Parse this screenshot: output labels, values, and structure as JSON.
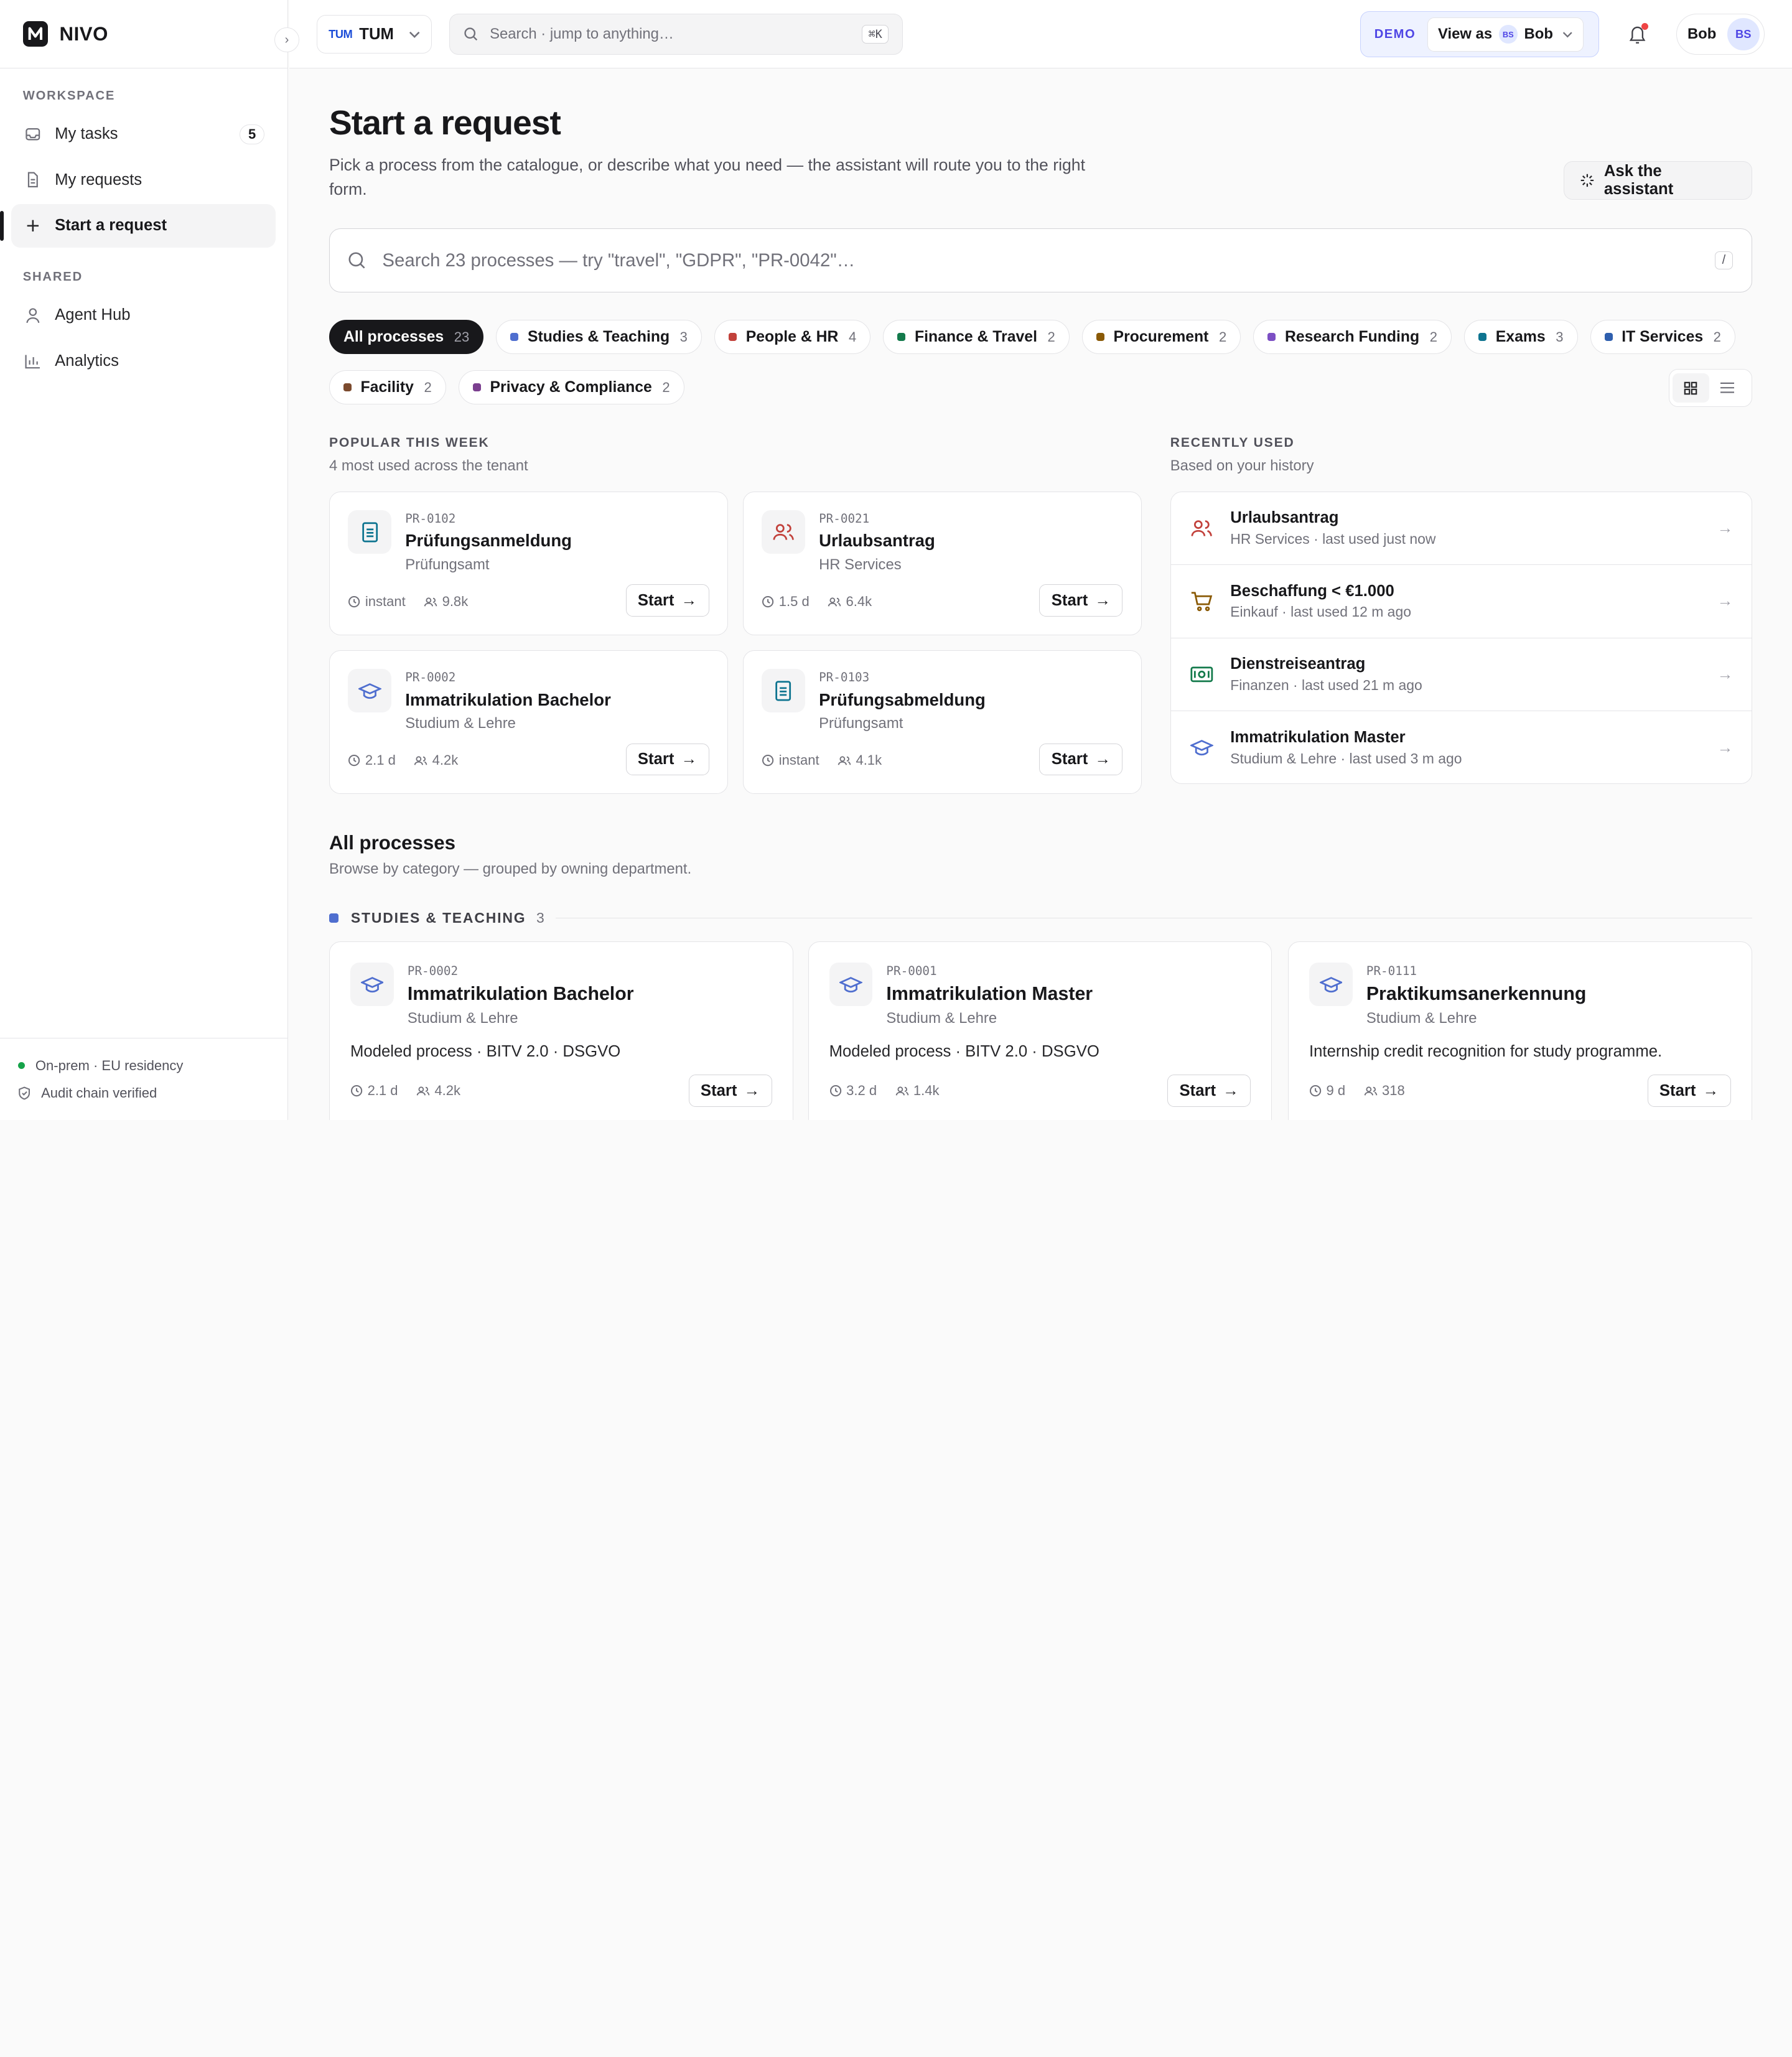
{
  "brand": {
    "name": "NIVO"
  },
  "sidebar": {
    "workspace_label": "WORKSPACE",
    "shared_label": "SHARED",
    "items": [
      {
        "label": "My tasks",
        "count": "5",
        "icon": "inbox-icon"
      },
      {
        "label": "My requests",
        "icon": "document-icon"
      },
      {
        "label": "Start a request",
        "icon": "plus-icon",
        "active": true
      }
    ],
    "shared_items": [
      {
        "label": "Agent Hub",
        "icon": "user-icon"
      },
      {
        "label": "Analytics",
        "icon": "bar-chart-icon"
      }
    ],
    "footer": {
      "residency": "On-prem · EU residency",
      "audit": "Audit chain verified"
    }
  },
  "topbar": {
    "tenant_logo": "TUM",
    "tenant": "TUM",
    "search_placeholder": "Search · jump to anything…",
    "search_shortcut": "⌘K",
    "demo_tag": "DEMO",
    "view_as_label": "View as",
    "view_as_initials": "BS",
    "view_as_user": "Bob",
    "user_name": "Bob",
    "user_initials": "BS"
  },
  "page": {
    "title": "Start a request",
    "subtitle": "Pick a process from the catalogue, or describe what you need — the assistant will route you to the right form.",
    "ask_button": "Ask the assistant",
    "search_placeholder": "Search 23 processes — try \"travel\", \"GDPR\", \"PR-0042\"…",
    "search_shortcut": "/"
  },
  "filters": [
    {
      "label": "All processes",
      "count": "23",
      "color": "#18181b"
    },
    {
      "label": "Studies & Teaching",
      "count": "3",
      "color": "#4f6ecf"
    },
    {
      "label": "People & HR",
      "count": "4",
      "color": "#c2413b"
    },
    {
      "label": "Finance & Travel",
      "count": "2",
      "color": "#137a4b"
    },
    {
      "label": "Procurement",
      "count": "2",
      "color": "#8a5a06"
    },
    {
      "label": "Research Funding",
      "count": "2",
      "color": "#7c4fc4"
    },
    {
      "label": "Exams",
      "count": "3",
      "color": "#0e7490"
    },
    {
      "label": "IT Services",
      "count": "2",
      "color": "#2f5fae"
    },
    {
      "label": "Facility",
      "count": "2",
      "color": "#7b4a2e"
    },
    {
      "label": "Privacy & Compliance",
      "count": "2",
      "color": "#7b3f8f"
    }
  ],
  "popular": {
    "heading": "POPULAR THIS WEEK",
    "subheading": "4 most used across the tenant",
    "cards": [
      {
        "code": "PR-0102",
        "title": "Prüfungsanmeldung",
        "dept": "Prüfungsamt",
        "time": "instant",
        "uses": "9.8k",
        "start": "Start",
        "icon": "document-icon",
        "color": "#0e7490"
      },
      {
        "code": "PR-0021",
        "title": "Urlaubsantrag",
        "dept": "HR Services",
        "time": "1.5 d",
        "uses": "6.4k",
        "start": "Start",
        "icon": "people-icon",
        "color": "#c2413b"
      },
      {
        "code": "PR-0002",
        "title": "Immatrikulation Bachelor",
        "dept": "Studium & Lehre",
        "time": "2.1 d",
        "uses": "4.2k",
        "start": "Start",
        "icon": "graduation-cap-icon",
        "color": "#4f6ecf"
      },
      {
        "code": "PR-0103",
        "title": "Prüfungsabmeldung",
        "dept": "Prüfungsamt",
        "time": "instant",
        "uses": "4.1k",
        "start": "Start",
        "icon": "document-icon",
        "color": "#0e7490"
      }
    ]
  },
  "recent": {
    "heading": "RECENTLY USED",
    "subheading": "Based on your history",
    "items": [
      {
        "title": "Urlaubsantrag",
        "sub": "HR Services · last used just now",
        "icon": "people-icon",
        "color": "#c2413b"
      },
      {
        "title": "Beschaffung < €1.000",
        "sub": "Einkauf · last used 12 m ago",
        "icon": "cart-icon",
        "color": "#8a5a06"
      },
      {
        "title": "Dienstreiseantrag",
        "sub": "Finanzen · last used 21 m ago",
        "icon": "money-icon",
        "color": "#137a4b"
      },
      {
        "title": "Immatrikulation Master",
        "sub": "Studium & Lehre · last used 3 m ago",
        "icon": "graduation-cap-icon",
        "color": "#4f6ecf"
      }
    ]
  },
  "all": {
    "heading": "All processes",
    "subheading": "Browse by category — grouped by owning department.",
    "group": {
      "label": "STUDIES & TEACHING",
      "count": "3",
      "color": "#4f6ecf"
    },
    "cards": [
      {
        "code": "PR-0002",
        "title": "Immatrikulation Bachelor",
        "dept": "Studium & Lehre",
        "desc": "Modeled process · BITV 2.0 · DSGVO",
        "time": "2.1 d",
        "uses": "4.2k",
        "start": "Start"
      },
      {
        "code": "PR-0001",
        "title": "Immatrikulation Master",
        "dept": "Studium & Lehre",
        "desc": "Modeled process · BITV 2.0 · DSGVO",
        "time": "3.2 d",
        "uses": "1.4k",
        "start": "Start"
      },
      {
        "code": "PR-0111",
        "title": "Praktikumsanerkennung",
        "dept": "Studium & Lehre",
        "desc": "Internship credit recognition for study programme.",
        "time": "9 d",
        "uses": "318",
        "start": "Start"
      }
    ]
  }
}
